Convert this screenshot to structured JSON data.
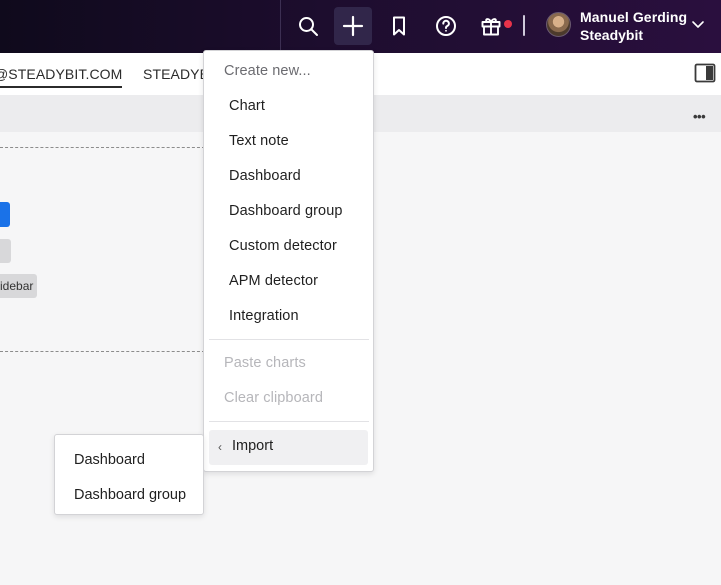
{
  "topbar": {
    "icons": [
      "search-icon",
      "plus-icon",
      "bookmark-icon",
      "help-icon",
      "gift-icon",
      "chevron-down-icon"
    ],
    "notification_color": "#e8334a",
    "user": {
      "name": "Manuel Gerding",
      "organization": "Steadybit"
    }
  },
  "subheader": {
    "tabs": [
      {
        "label": "@STEADYBIT.COM",
        "active": true
      },
      {
        "label": "STEADYBI"
      }
    ]
  },
  "toolbar": {
    "more_label": "•••"
  },
  "canvas": {
    "sidebar_chip_label": "idebar",
    "accent_color": "#1a72e8"
  },
  "create_menu": {
    "heading": "Create new...",
    "items": [
      {
        "label": "Chart"
      },
      {
        "label": "Text note"
      },
      {
        "label": "Dashboard"
      },
      {
        "label": "Dashboard group"
      },
      {
        "label": "Custom detector"
      },
      {
        "label": "APM detector"
      },
      {
        "label": "Integration"
      }
    ],
    "disabled_items": [
      {
        "label": "Paste charts"
      },
      {
        "label": "Clear clipboard"
      }
    ],
    "import": {
      "chevron": "‹",
      "label": "Import"
    }
  },
  "import_submenu": {
    "items": [
      {
        "label": "Dashboard"
      },
      {
        "label": "Dashboard group"
      }
    ]
  }
}
